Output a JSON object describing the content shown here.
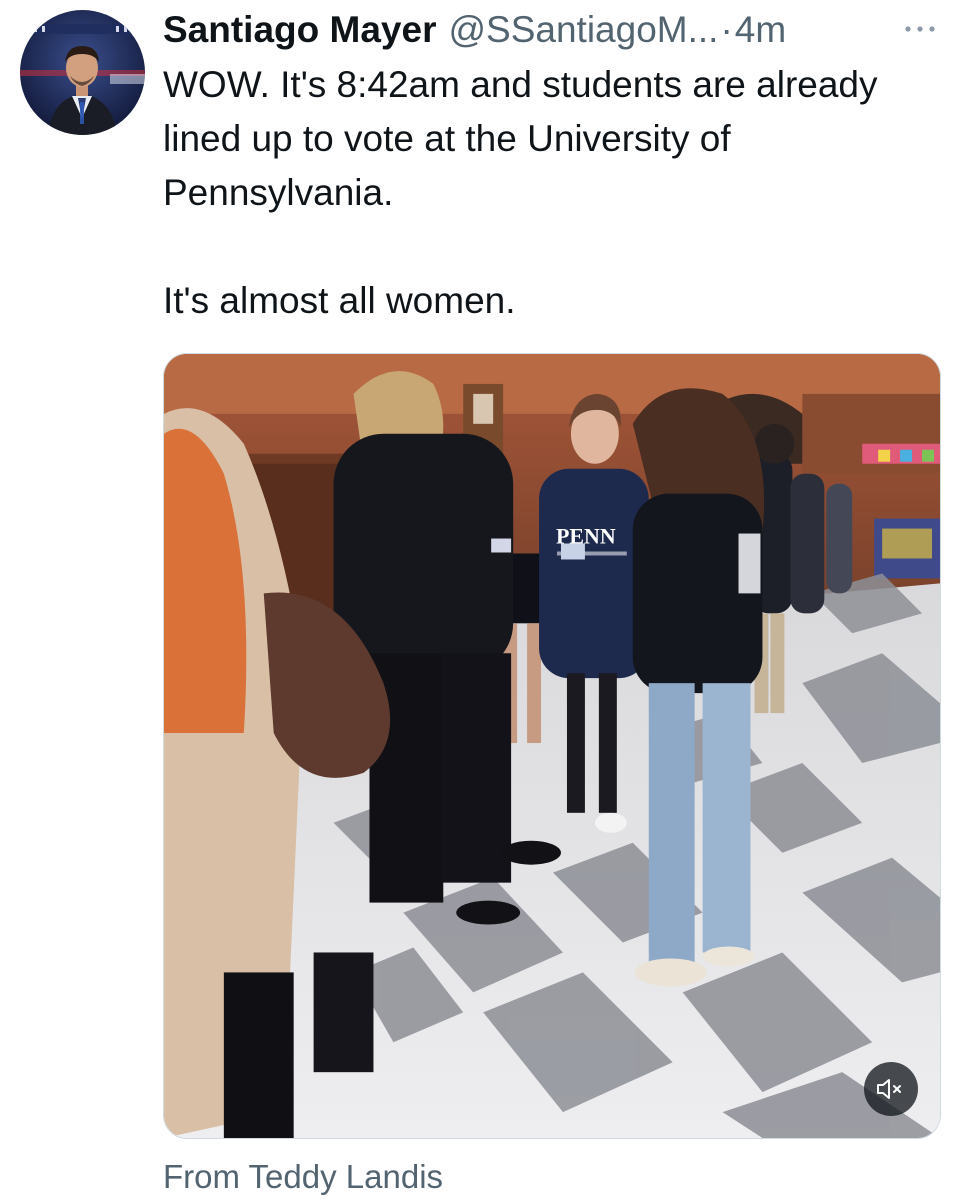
{
  "tweet": {
    "author": {
      "display_name": "Santiago Mayer",
      "handle": "@SSantiagoM..."
    },
    "separator": "·",
    "timestamp": "4m",
    "text": "WOW. It's 8:42am and students are already lined up to vote at the University of Pennsylvania.\n\nIt's almost all women.",
    "media": {
      "shirt_text": "PENN",
      "mute_icon": "speaker-muted-icon"
    },
    "attribution": "From Teddy Landis"
  },
  "icons": {
    "more": "more-horizontal-icon",
    "mute": "speaker-muted-icon"
  },
  "colors": {
    "text_primary": "#0f1419",
    "text_secondary": "#536471",
    "border": "#cfd9de"
  }
}
